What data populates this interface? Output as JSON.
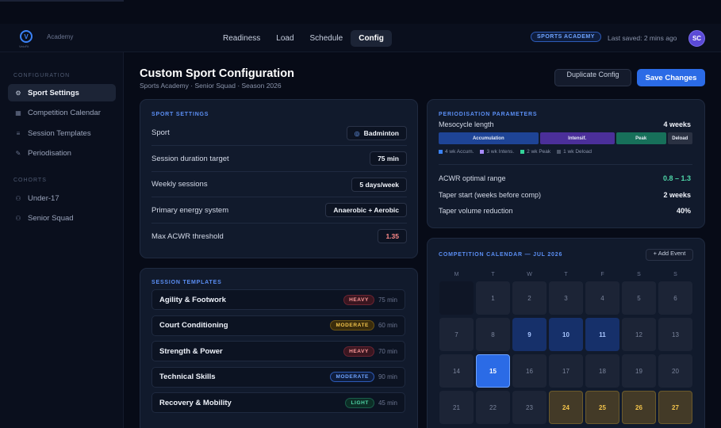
{
  "app": {
    "brand": "Academy",
    "logo_letter": "V",
    "logo_sub": "VeloFit"
  },
  "nav": {
    "tabs": [
      {
        "label": "Readiness",
        "active": false
      },
      {
        "label": "Load",
        "active": false
      },
      {
        "label": "Schedule",
        "active": false
      },
      {
        "label": "Config",
        "active": true
      }
    ],
    "academy_badge": "SPORTS ACADEMY",
    "last_saved": "Last saved: 2 mins ago",
    "avatar_initials": "SC"
  },
  "sidebar": {
    "config_heading": "CONFIGURATION",
    "config_items": [
      {
        "label": "Sport Settings",
        "icon": "settings-icon",
        "active": true
      },
      {
        "label": "Competition Calendar",
        "icon": "calendar-icon",
        "active": false
      },
      {
        "label": "Session Templates",
        "icon": "list-icon",
        "active": false
      },
      {
        "label": "Periodisation",
        "icon": "pen-icon",
        "active": false
      }
    ],
    "cohorts_heading": "COHORTS",
    "cohort_items": [
      {
        "label": "Under-17",
        "icon": "user-icon"
      },
      {
        "label": "Senior Squad",
        "icon": "user-icon"
      }
    ]
  },
  "header": {
    "title": "Custom Sport Configuration",
    "subtitle": "Sports Academy · Senior Squad · Season 2026",
    "duplicate_label": "Duplicate Config",
    "save_label": "Save Changes"
  },
  "sport_settings": {
    "title": "SPORT SETTINGS",
    "rows": [
      {
        "label": "Sport",
        "value": "Badminton"
      },
      {
        "label": "Session duration target",
        "value": "75 min"
      },
      {
        "label": "Weekly sessions",
        "value": "5 days/week"
      },
      {
        "label": "Primary energy system",
        "value": "Anaerobic + Aerobic"
      },
      {
        "label": "Max ACWR threshold",
        "value": "1.35"
      }
    ]
  },
  "session_templates": {
    "title": "SESSION TEMPLATES",
    "items": [
      {
        "name": "Agility & Footwork",
        "intensity": "HEAVY",
        "duration": "75 min"
      },
      {
        "name": "Court Conditioning",
        "intensity": "MODERATE",
        "duration": "60 min"
      },
      {
        "name": "Strength & Power",
        "intensity": "HEAVY",
        "duration": "70 min"
      },
      {
        "name": "Technical Skills",
        "intensity": "MODERATE",
        "duration": "90 min"
      },
      {
        "name": "Recovery & Mobility",
        "intensity": "LIGHT",
        "duration": "45 min"
      }
    ]
  },
  "periodisation": {
    "title": "PERIODISATION PARAMETERS",
    "mesocycle_label": "Mesocycle length",
    "mesocycle_value": "4 weeks",
    "phases": [
      {
        "label": "Accumulation",
        "weeks": 4,
        "color": "#1e4496"
      },
      {
        "label": "Intensif.",
        "weeks": 3,
        "color": "#4b2f9a"
      },
      {
        "label": "Peak",
        "weeks": 2,
        "color": "#17705a"
      },
      {
        "label": "Deload",
        "weeks": 1,
        "color": "#2a3142"
      }
    ],
    "legend": [
      {
        "label": "4 wk Accum.",
        "color": "#3b82f6"
      },
      {
        "label": "3 wk Intens.",
        "color": "#a78bfa"
      },
      {
        "label": "2 wk Peak",
        "color": "#34d399"
      },
      {
        "label": "1 wk Deload",
        "color": "#4b5568"
      }
    ],
    "params": [
      {
        "label": "ACWR optimal range",
        "value": "0.8 – 1.3",
        "accent": true
      },
      {
        "label": "Taper start (weeks before comp)",
        "value": "2 weeks",
        "accent": false
      },
      {
        "label": "Taper volume reduction",
        "value": "40%",
        "accent": false
      }
    ]
  },
  "calendar": {
    "title": "COMPETITION CALENDAR — JUL 2026",
    "add_label": "+ Add Event",
    "weekdays": [
      "M",
      "T",
      "W",
      "T",
      "F",
      "S",
      "S"
    ],
    "weeks": [
      [
        null,
        "1",
        "2",
        "3",
        "4",
        "5",
        "6"
      ],
      [
        "7",
        "8",
        "9",
        "10",
        "11",
        "12",
        "13"
      ],
      [
        "14",
        "15",
        "16",
        "17",
        "18",
        "19",
        "20"
      ],
      [
        "21",
        "22",
        "23",
        "24",
        "25",
        "26",
        "27"
      ]
    ],
    "training_days": [
      "9",
      "10",
      "11"
    ],
    "today": "15",
    "competition_days": [
      "24",
      "25",
      "26",
      "27"
    ]
  }
}
